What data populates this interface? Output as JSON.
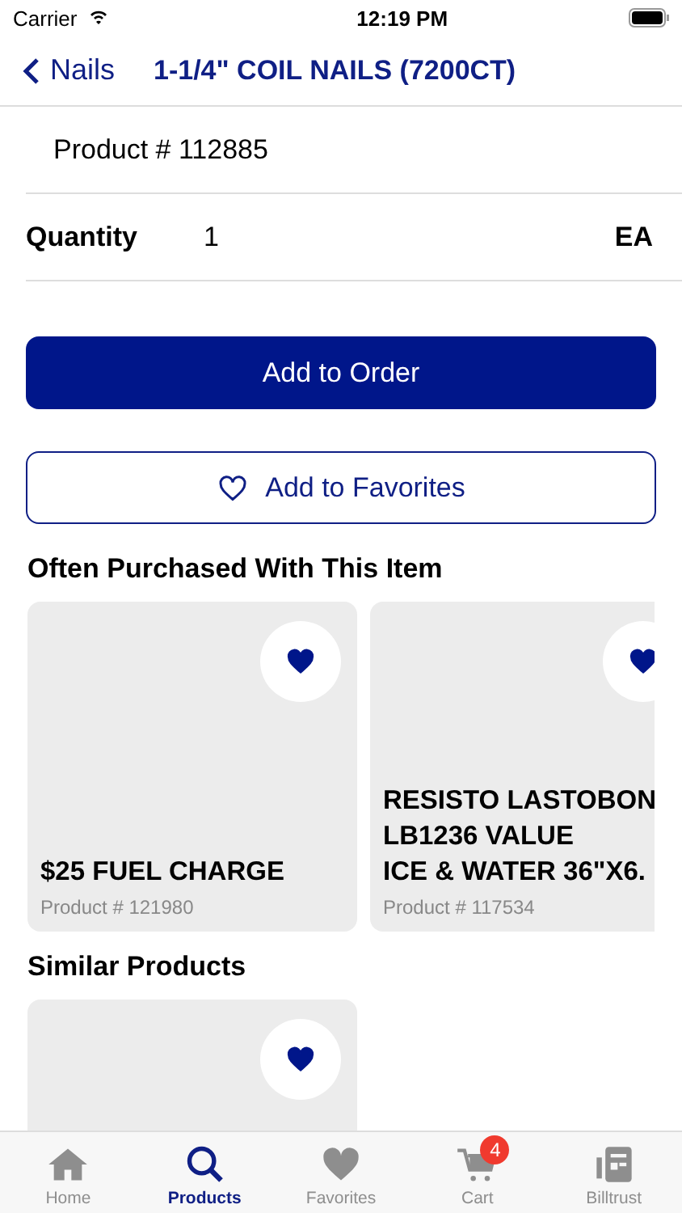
{
  "status_bar": {
    "carrier": "Carrier",
    "time": "12:19 PM"
  },
  "nav": {
    "back": "Nails",
    "title": "1-1/4\" COIL NAILS (7200CT)"
  },
  "product_number": "Product # 112885",
  "quantity": {
    "label": "Quantity",
    "value": "1",
    "unit": "EA"
  },
  "buttons": {
    "add_to_order": "Add to Order",
    "add_to_favorites": "Add to Favorites"
  },
  "sections": [
    {
      "title": "Often Purchased With This Item",
      "items": [
        {
          "title_lines": [
            "$25 FUEL CHARGE"
          ],
          "product": "Product # 121980",
          "favorite": true
        },
        {
          "title_lines": [
            "RESISTO LASTOBON",
            "LB1236 VALUE",
            "ICE & WATER 36\"X6."
          ],
          "product": "Product # 117534",
          "favorite": true
        }
      ]
    },
    {
      "title": "Similar Products",
      "items": [
        {
          "favorite": true
        }
      ]
    }
  ],
  "tabs": [
    {
      "label": "Home",
      "kind": "home",
      "selected": false
    },
    {
      "label": "Products",
      "kind": "search",
      "selected": true
    },
    {
      "label": "Favorites",
      "kind": "heart",
      "selected": false
    },
    {
      "label": "Cart",
      "kind": "cart",
      "selected": false,
      "badge": "4"
    },
    {
      "label": "Billtrust",
      "kind": "doc",
      "selected": false
    }
  ]
}
